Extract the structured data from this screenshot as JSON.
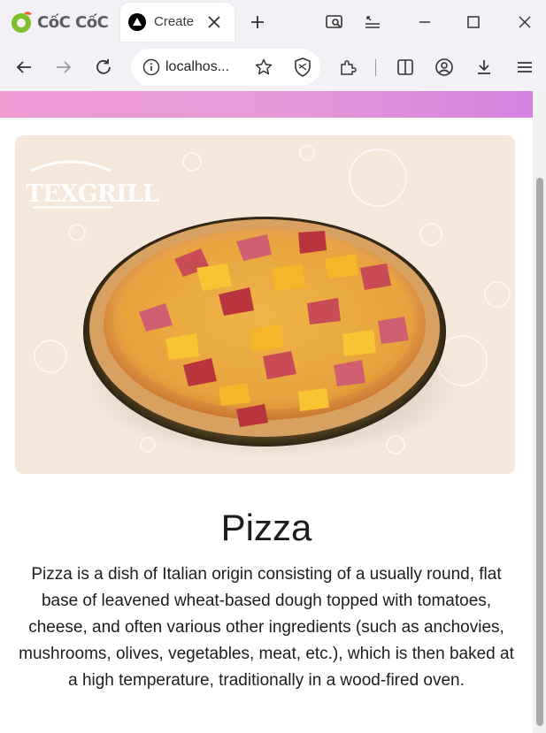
{
  "browser": {
    "brand_name": "CốC CốC",
    "tab": {
      "title": "Create"
    },
    "address_bar": {
      "url": "localhos..."
    }
  },
  "page": {
    "hero_image": {
      "alt": "Pizza",
      "watermark": "TEXGRILL"
    },
    "title": "Pizza",
    "description": "Pizza is a dish of Italian origin consisting of a usually round, flat base of leavened wheat-based dough topped with tomatoes, cheese, and often various other ingredients (such as anchovies, mushrooms, olives, vegetables, meat, etc.), which is then baked at a high temperature, traditionally in a wood-fired oven."
  },
  "icons": [
    "coccoc-logo-icon",
    "app-favicon-icon",
    "close-icon",
    "plus-icon",
    "screenshot-search-icon",
    "minimize-icon",
    "maximize-icon",
    "close-window-icon",
    "back-icon",
    "forward-icon",
    "reload-icon",
    "info-icon",
    "star-icon",
    "shield-icon",
    "extensions-icon",
    "split-view-icon",
    "profile-icon",
    "download-icon",
    "menu-icon"
  ],
  "colors": {
    "gradient_start": "#f09ad3",
    "gradient_end": "#d781df",
    "hero_background": "#f5e7da",
    "browser_chrome": "#f3f1f6"
  }
}
